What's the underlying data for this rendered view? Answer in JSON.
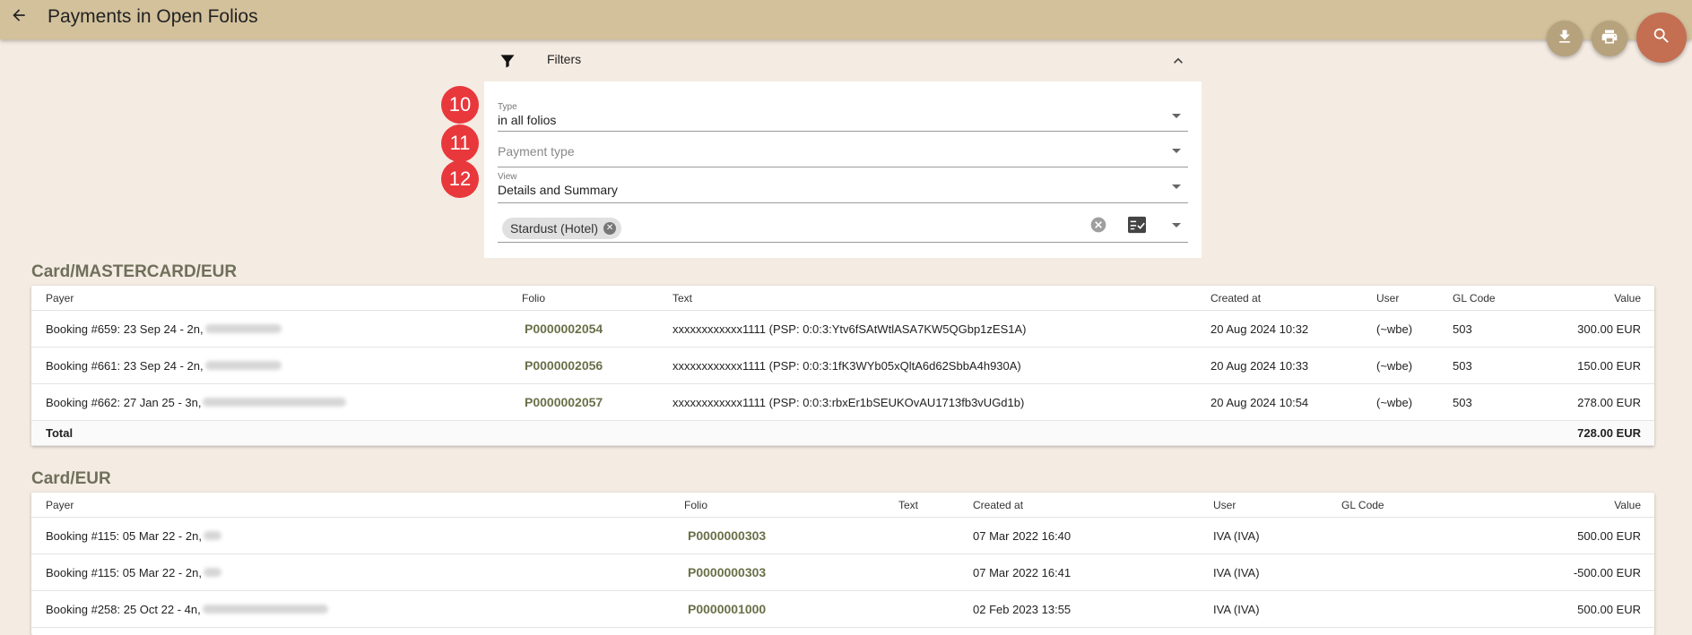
{
  "app": {
    "title": "Payments in Open Folios"
  },
  "icons": {
    "back": "arrow-back-icon",
    "download": "download-icon",
    "print": "printer-icon",
    "search": "search-icon",
    "filter": "filter-funnel-icon",
    "collapse": "chevron-up-icon",
    "clear": "clear-circle-icon",
    "select_all": "checklist-icon",
    "dropdown": "caret-down-icon"
  },
  "colors": {
    "topbar": "#d3c19c",
    "fab_small": "#b6a27c",
    "fab_search": "#c46f52",
    "badge": "#e8383c",
    "folio_link": "#6a7048",
    "section_title": "#6f6f5b"
  },
  "filters": {
    "header_label": "Filters",
    "type": {
      "label": "Type",
      "value": "in all folios",
      "badge": "10"
    },
    "payment_type": {
      "placeholder": "Payment type",
      "badge": "11"
    },
    "view": {
      "label": "View",
      "value": "Details and Summary",
      "badge": "12"
    },
    "property_chip": "Stardust (Hotel)"
  },
  "sections": [
    {
      "title": "Card/MASTERCARD/EUR",
      "columns": [
        "Payer",
        "Folio",
        "Text",
        "Created at",
        "User",
        "GL Code",
        "Value"
      ],
      "rows": [
        {
          "payer": "Booking #659: 23 Sep 24 - 2n, ",
          "folio": "P0000002054",
          "text": "xxxxxxxxxxxx1111 (PSP: 0:0:3:Ytv6fSAtWtlASA7KW5QGbp1zES1A)",
          "created": "20 Aug 2024 10:32",
          "user": "(~wbe)",
          "gl": "503",
          "value": "300.00 EUR"
        },
        {
          "payer": "Booking #661: 23 Sep 24 - 2n, ",
          "folio": "P0000002056",
          "text": "xxxxxxxxxxxx1111 (PSP: 0:0:3:1fK3WYb05xQltA6d62SbbA4h930A)",
          "created": "20 Aug 2024 10:33",
          "user": "(~wbe)",
          "gl": "503",
          "value": "150.00 EUR"
        },
        {
          "payer": "Booking #662: 27 Jan 25 - 3n, ",
          "folio": "P0000002057",
          "text": "xxxxxxxxxxxx1111 (PSP: 0:0:3:rbxEr1bSEUKOvAU1713fb3vUGd1b)",
          "created": "20 Aug 2024 10:54",
          "user": "(~wbe)",
          "gl": "503",
          "value": "278.00 EUR"
        }
      ],
      "total_label": "Total",
      "total_value": "728.00 EUR"
    },
    {
      "title": "Card/EUR",
      "columns": [
        "Payer",
        "Folio",
        "Text",
        "Created at",
        "User",
        "GL Code",
        "Value"
      ],
      "rows": [
        {
          "payer": "Booking #115: 05 Mar 22 - 2n, ",
          "folio": "P0000000303",
          "text": "",
          "created": "07 Mar 2022 16:40",
          "user": "IVA (IVA)",
          "gl": "",
          "value_num": "500.00",
          "value_cur": "EUR"
        },
        {
          "payer": "Booking #115: 05 Mar 22 - 2n, ",
          "folio": "P0000000303",
          "text": "",
          "created": "07 Mar 2022 16:41",
          "user": "IVA (IVA)",
          "gl": "",
          "value_num": "-500.00",
          "value_cur": "EUR"
        },
        {
          "payer": "Booking #258: 25 Oct 22 - 4n, ",
          "folio": "P0000001000",
          "text": "",
          "created": "02 Feb 2023 13:55",
          "user": "IVA (IVA)",
          "gl": "",
          "value_num": "500.00",
          "value_cur": "EUR"
        }
      ]
    }
  ]
}
